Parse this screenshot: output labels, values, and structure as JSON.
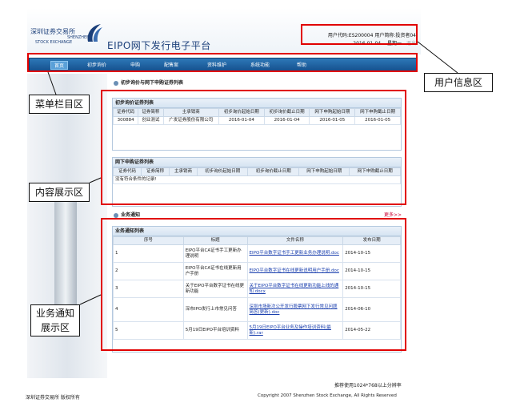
{
  "header": {
    "logo_cn": "深圳证券交易所",
    "logo_en_line1": "SHENZHEN",
    "logo_en_line2": "STOCK EXCHANGE",
    "app_title": "EIPO网下发行电子平台"
  },
  "user_info": {
    "line1": "用户代码:ES200004  用户简称:投资者04",
    "date": "2016-01-04",
    "weekday": "星期一",
    "logout": "退出"
  },
  "nav": {
    "items": [
      {
        "label": "首页",
        "active": true
      },
      {
        "label": "初步询价",
        "active": false
      },
      {
        "label": "申购",
        "active": false
      },
      {
        "label": "配售案",
        "active": false
      },
      {
        "label": "资料维护",
        "active": false
      },
      {
        "label": "系统功能",
        "active": false
      },
      {
        "label": "帮助",
        "active": false
      }
    ]
  },
  "main": {
    "section1_title": "初步询价与网下申购证券列表",
    "panel_inquiry": {
      "title": "初步询价证券列表",
      "headers": [
        "证券代码",
        "证券简称",
        "主承销商",
        "初步询价起始日期",
        "初步询价截止日期",
        "网下申购起始日期",
        "网下申购截止日期"
      ],
      "rows": [
        [
          "300884",
          "创业测试",
          "广发证券股份有限公司",
          "2016-01-04",
          "2016-01-04",
          "2016-01-05",
          "2016-01-05"
        ]
      ]
    },
    "panel_subscription": {
      "title": "网下申购证券列表",
      "headers": [
        "证券代码",
        "证券简称",
        "主承销商",
        "初步询价起始日期",
        "初步询价截止日期",
        "网下申购起始日期",
        "网下申购截止日期"
      ],
      "empty_text": "没有符合条件的记录!"
    },
    "section2_title": "业务通知",
    "more": "更多>>",
    "panel_notices": {
      "title": "业务通知列表",
      "headers": [
        "序号",
        "标题",
        "文件名称",
        "发布日期"
      ],
      "rows": [
        {
          "no": "1",
          "title": "EIPO平台CA证书手工更新办理说明",
          "file": "EIPO平台数字证书手工更新业务办理说明.doc",
          "date": "2014-10-15"
        },
        {
          "no": "2",
          "title": "EIPO平台CA证书在线更新用户手册",
          "file": "EIPO平台数字证书在线更新说明用户手册.doc",
          "date": "2014-10-15"
        },
        {
          "no": "3",
          "title": "关于EIPO平台数字证书在线更新功能",
          "file": "关于EIPO平台数字证书在线更新功能上线的通知.docx",
          "date": "2014-10-15"
        },
        {
          "no": "4",
          "title": "深市IPO发行上市常见问答",
          "file": "深圳市场新次公开发行股票网下发行常见问题简答(更新).doc",
          "date": "2014-06-10"
        },
        {
          "no": "5",
          "title": "5月19日EIPO平台培训资料",
          "file": "5月19日EIPO平台业务及操作培训资料(最新).rar",
          "date": "2014-05-22"
        }
      ]
    }
  },
  "footer": {
    "resolution_note": "推荐使用1024*768以上分辨率",
    "left": "深圳证券交易所  版权所有",
    "copyright": "Copyright 2007 Shenzhen Stock Exchange, All Rights Reserved"
  },
  "annotations": {
    "user_area": "用户信息区",
    "menu_area": "菜单栏目区",
    "content_area": "内容展示区",
    "notice_area_line1": "业务通知",
    "notice_area_line2": "展示区",
    "color": "#e10000"
  }
}
